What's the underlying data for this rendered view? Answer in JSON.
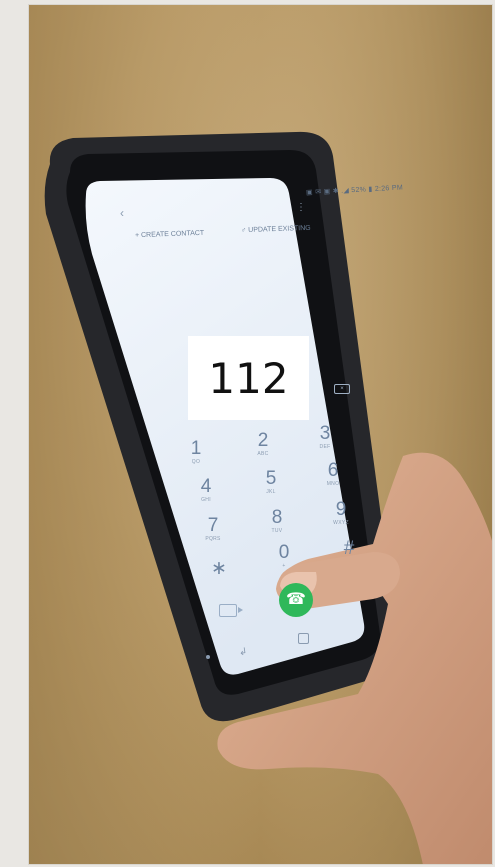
{
  "dialer": {
    "status_bar": "▣ ✉ ▣ ✱ .◢ 52% ▮ 2:26 PM",
    "back_icon": "chevron-left-icon",
    "more_icon": "more-vertical-icon",
    "create_contact": "+ CREATE CONTACT",
    "update_existing": "♂ UPDATE EXISTING",
    "delete_icon": "backspace-icon",
    "dialed_number": "112",
    "keys": [
      {
        "digit": "1",
        "letters": "QO"
      },
      {
        "digit": "2",
        "letters": "ABC"
      },
      {
        "digit": "3",
        "letters": "DEF"
      },
      {
        "digit": "4",
        "letters": "GHI"
      },
      {
        "digit": "5",
        "letters": "JKL"
      },
      {
        "digit": "6",
        "letters": "MNO"
      },
      {
        "digit": "7",
        "letters": "PQRS"
      },
      {
        "digit": "8",
        "letters": "TUV"
      },
      {
        "digit": "9",
        "letters": "WXYZ"
      },
      {
        "digit": "∗",
        "letters": ""
      },
      {
        "digit": "0",
        "letters": "+"
      },
      {
        "digit": "#",
        "letters": ""
      }
    ],
    "call_icon": "phone-icon",
    "video_icon": "video-call-icon"
  },
  "colors": {
    "wall": "#b89965",
    "case": "#2b2c30",
    "screen": "#eef3fa",
    "call_button": "#2fb85a",
    "skin": "#d9a88a"
  }
}
